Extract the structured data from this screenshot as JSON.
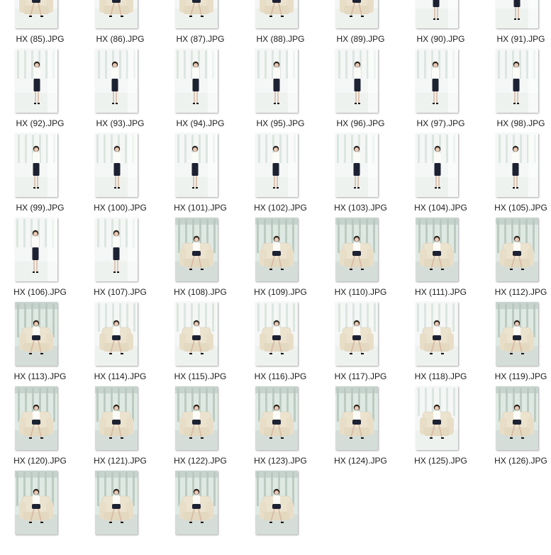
{
  "files": [
    {
      "name": "HX (85).JPG",
      "scene": "sofa-bright"
    },
    {
      "name": "HX (86).JPG",
      "scene": "sofa-bright"
    },
    {
      "name": "HX (87).JPG",
      "scene": "sofa-bright"
    },
    {
      "name": "HX (88).JPG",
      "scene": "sofa-bright"
    },
    {
      "name": "HX (89).JPG",
      "scene": "sofa-bright"
    },
    {
      "name": "HX (90).JPG",
      "scene": "standing-bright"
    },
    {
      "name": "HX (91).JPG",
      "scene": "standing-bright"
    },
    {
      "name": "HX (92).JPG",
      "scene": "standing-bright"
    },
    {
      "name": "HX (93).JPG",
      "scene": "standing-bright"
    },
    {
      "name": "HX (94).JPG",
      "scene": "standing-bright"
    },
    {
      "name": "HX (95).JPG",
      "scene": "standing-bright"
    },
    {
      "name": "HX (96).JPG",
      "scene": "standing-bright"
    },
    {
      "name": "HX (97).JPG",
      "scene": "standing-bright"
    },
    {
      "name": "HX (98).JPG",
      "scene": "standing-bright"
    },
    {
      "name": "HX (99).JPG",
      "scene": "standing-bright"
    },
    {
      "name": "HX (100).JPG",
      "scene": "standing-bright"
    },
    {
      "name": "HX (101).JPG",
      "scene": "standing-bright"
    },
    {
      "name": "HX (102).JPG",
      "scene": "standing-bright"
    },
    {
      "name": "HX (103).JPG",
      "scene": "standing-bright"
    },
    {
      "name": "HX (104).JPG",
      "scene": "standing-bright"
    },
    {
      "name": "HX (105).JPG",
      "scene": "standing-bright"
    },
    {
      "name": "HX (106).JPG",
      "scene": "standing-bright"
    },
    {
      "name": "HX (107).JPG",
      "scene": "standing-bright"
    },
    {
      "name": "HX (108).JPG",
      "scene": "sofa-hall"
    },
    {
      "name": "HX (109).JPG",
      "scene": "sofa-hall"
    },
    {
      "name": "HX (110).JPG",
      "scene": "sofa-hall"
    },
    {
      "name": "HX (111).JPG",
      "scene": "sofa-hall"
    },
    {
      "name": "HX (112).JPG",
      "scene": "sofa-hall"
    },
    {
      "name": "HX (113).JPG",
      "scene": "sofa-hall"
    },
    {
      "name": "HX (114).JPG",
      "scene": "sofa-bright"
    },
    {
      "name": "HX (115).JPG",
      "scene": "sofa-bright"
    },
    {
      "name": "HX (116).JPG",
      "scene": "sofa-bright"
    },
    {
      "name": "HX (117).JPG",
      "scene": "sofa-bright"
    },
    {
      "name": "HX (118).JPG",
      "scene": "sofa-bright"
    },
    {
      "name": "HX (119).JPG",
      "scene": "sofa-hall"
    },
    {
      "name": "HX (120).JPG",
      "scene": "sofa-hall"
    },
    {
      "name": "HX (121).JPG",
      "scene": "sofa-hall"
    },
    {
      "name": "HX (122).JPG",
      "scene": "sofa-hall"
    },
    {
      "name": "HX (123).JPG",
      "scene": "sofa-hall"
    },
    {
      "name": "HX (124).JPG",
      "scene": "sofa-hall"
    },
    {
      "name": "HX (125).JPG",
      "scene": "sofa-bright"
    },
    {
      "name": "HX (126).JPG",
      "scene": "sofa-hall"
    },
    {
      "name": "",
      "scene": "sofa-hall"
    },
    {
      "name": "",
      "scene": "sofa-hall"
    },
    {
      "name": "",
      "scene": "sofa-hall"
    },
    {
      "name": "",
      "scene": "sofa-hall"
    }
  ]
}
